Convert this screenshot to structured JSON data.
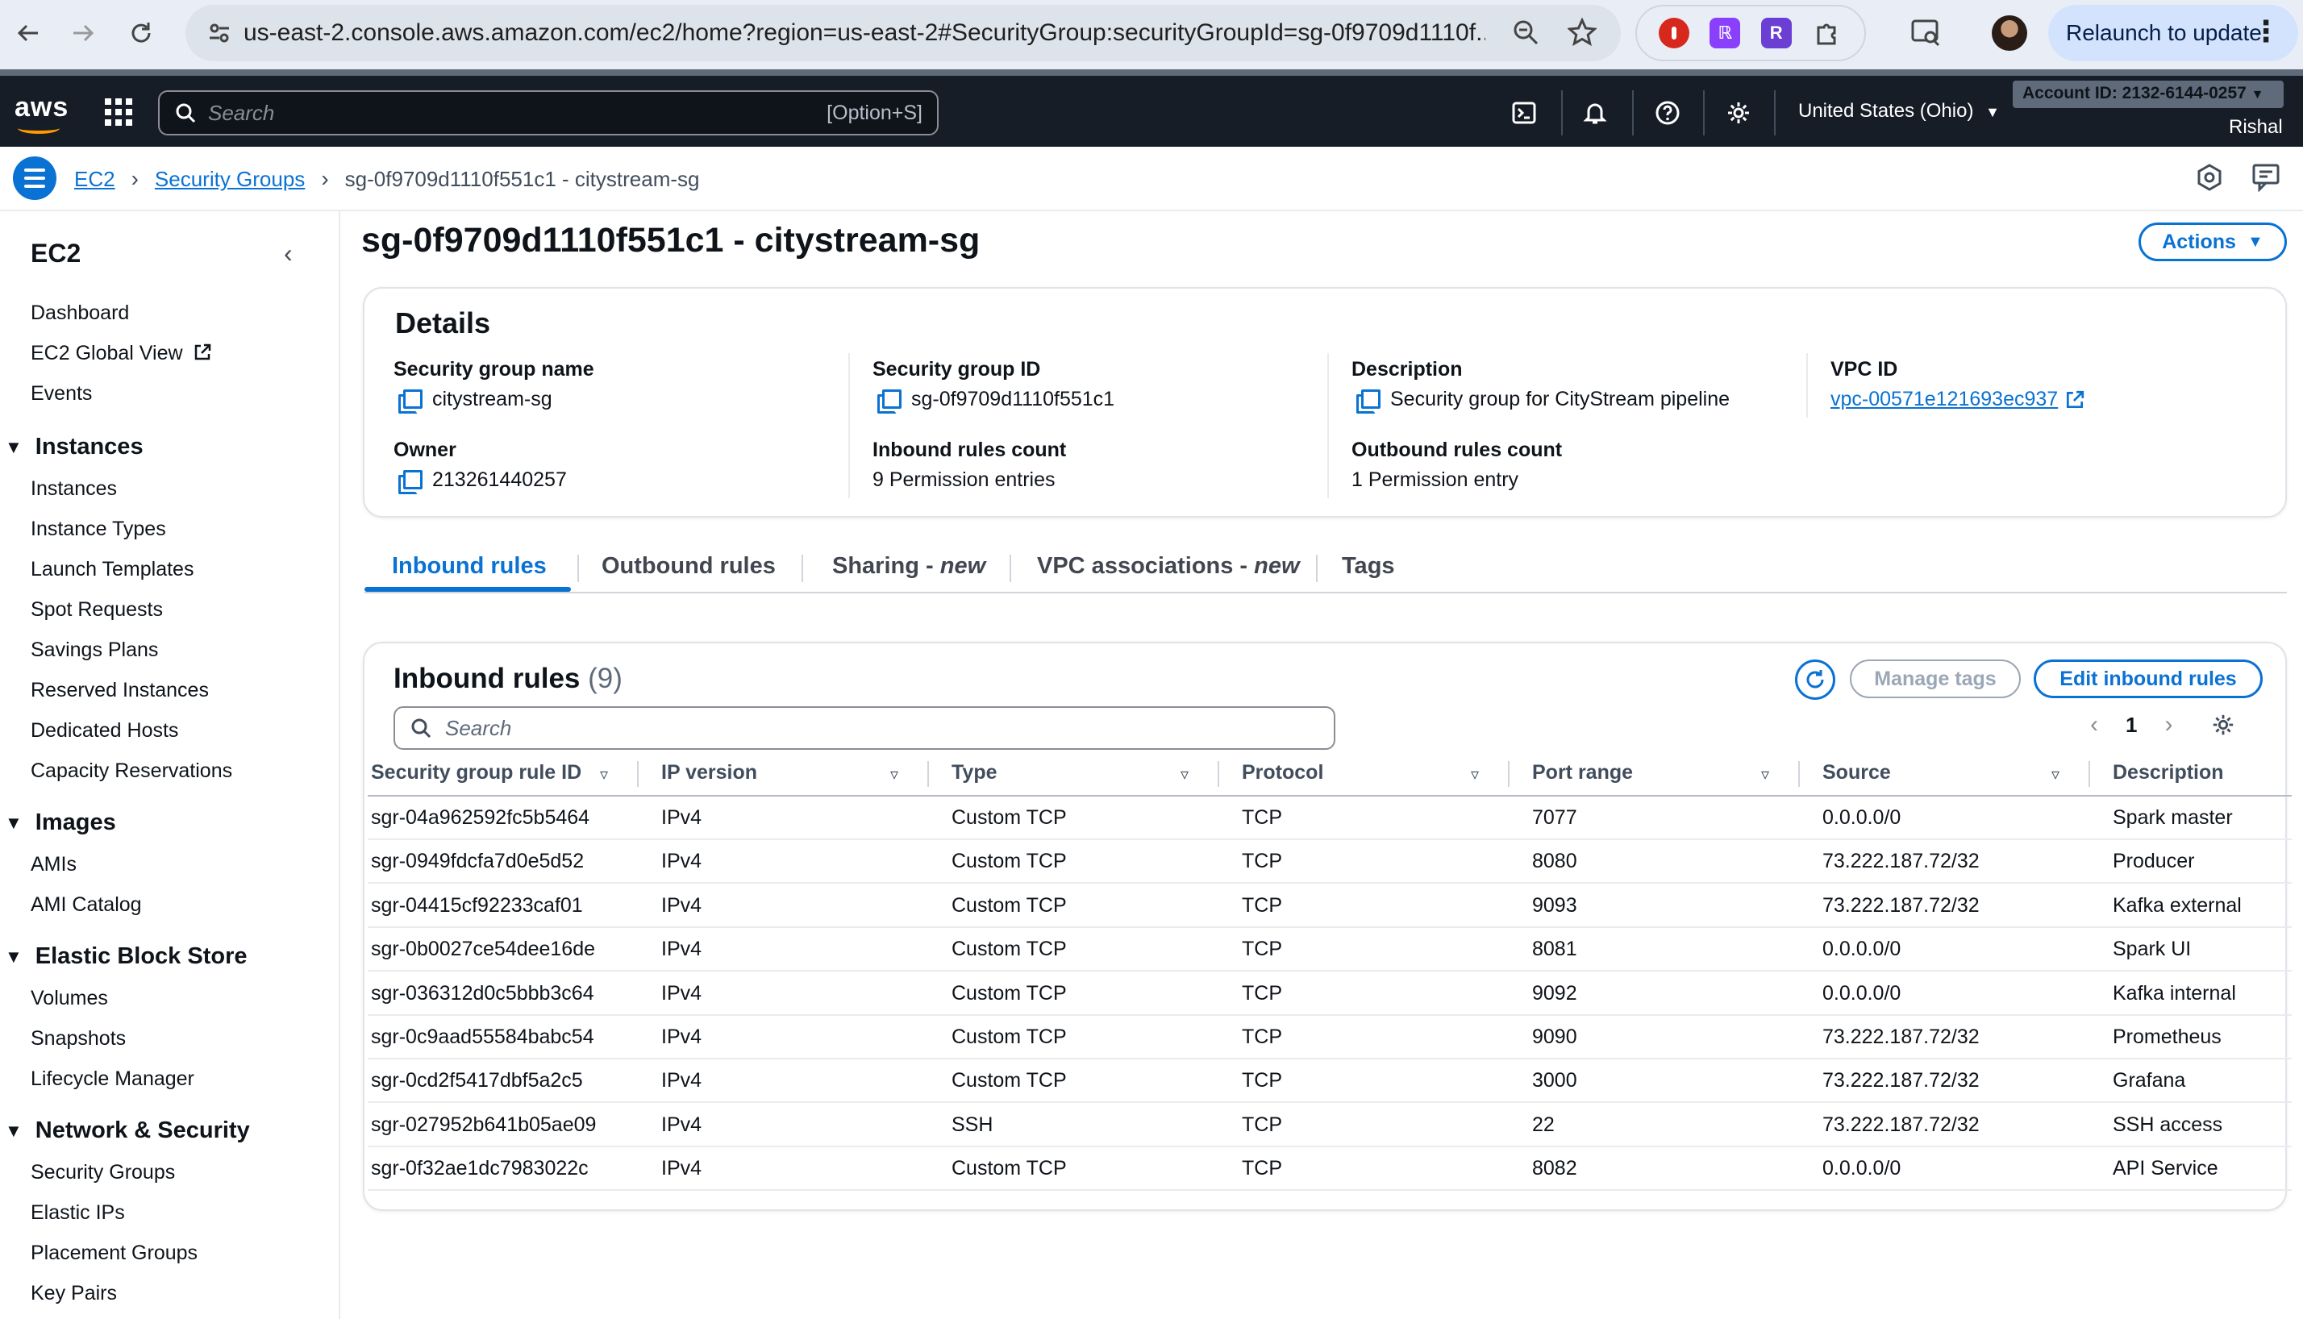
{
  "browser": {
    "url": "us-east-2.console.aws.amazon.com/ec2/home?region=us-east-2#SecurityGroup:securityGroupId=sg-0f9709d1110f...",
    "relaunch_label": "Relaunch to update"
  },
  "aws": {
    "logo": "aws",
    "search_placeholder": "Search",
    "search_shortcut": "[Option+S]",
    "region": "United States (Ohio)",
    "account": "Account ID: 2132-6144-0257",
    "user": "Rishal"
  },
  "breadcrumb": {
    "items": [
      "EC2",
      "Security Groups"
    ],
    "current": "sg-0f9709d1110f551c1 - citystream-sg"
  },
  "sidenav": {
    "title": "EC2",
    "top_items": [
      "Dashboard",
      "EC2 Global View",
      "Events"
    ],
    "sections": [
      {
        "label": "Instances",
        "items": [
          "Instances",
          "Instance Types",
          "Launch Templates",
          "Spot Requests",
          "Savings Plans",
          "Reserved Instances",
          "Dedicated Hosts",
          "Capacity Reservations"
        ]
      },
      {
        "label": "Images",
        "items": [
          "AMIs",
          "AMI Catalog"
        ]
      },
      {
        "label": "Elastic Block Store",
        "items": [
          "Volumes",
          "Snapshots",
          "Lifecycle Manager"
        ]
      },
      {
        "label": "Network & Security",
        "items": [
          "Security Groups",
          "Elastic IPs",
          "Placement Groups",
          "Key Pairs"
        ]
      }
    ]
  },
  "page": {
    "title": "sg-0f9709d1110f551c1 - citystream-sg",
    "actions_label": "Actions"
  },
  "details": {
    "heading": "Details",
    "sg_name_label": "Security group name",
    "sg_name": "citystream-sg",
    "sg_id_label": "Security group ID",
    "sg_id": "sg-0f9709d1110f551c1",
    "description_label": "Description",
    "description": "Security group for CityStream pipeline",
    "vpc_label": "VPC ID",
    "vpc_id": "vpc-00571e121693ec937",
    "owner_label": "Owner",
    "owner": "213261440257",
    "inbound_count_label": "Inbound rules count",
    "inbound_count": "9 Permission entries",
    "outbound_count_label": "Outbound rules count",
    "outbound_count": "1 Permission entry"
  },
  "tabs": {
    "inbound": "Inbound rules",
    "outbound": "Outbound rules",
    "sharing": "Sharing - ",
    "sharing_new": "new",
    "vpc_assoc": "VPC associations - ",
    "vpc_assoc_new": "new",
    "tags": "Tags"
  },
  "inbound": {
    "title": "Inbound rules",
    "count": "(9)",
    "manage_tags": "Manage tags",
    "edit_rules": "Edit inbound rules",
    "search_placeholder": "Search",
    "page": "1",
    "columns": [
      "Security group rule ID",
      "IP version",
      "Type",
      "Protocol",
      "Port range",
      "Source",
      "Description"
    ],
    "rows": [
      [
        "sgr-04a962592fc5b5464",
        "IPv4",
        "Custom TCP",
        "TCP",
        "7077",
        "0.0.0.0/0",
        "Spark master"
      ],
      [
        "sgr-0949fdcfa7d0e5d52",
        "IPv4",
        "Custom TCP",
        "TCP",
        "8080",
        "73.222.187.72/32",
        "Producer"
      ],
      [
        "sgr-04415cf92233caf01",
        "IPv4",
        "Custom TCP",
        "TCP",
        "9093",
        "73.222.187.72/32",
        "Kafka external"
      ],
      [
        "sgr-0b0027ce54dee16de",
        "IPv4",
        "Custom TCP",
        "TCP",
        "8081",
        "0.0.0.0/0",
        "Spark UI"
      ],
      [
        "sgr-036312d0c5bbb3c64",
        "IPv4",
        "Custom TCP",
        "TCP",
        "9092",
        "0.0.0.0/0",
        "Kafka internal"
      ],
      [
        "sgr-0c9aad55584babc54",
        "IPv4",
        "Custom TCP",
        "TCP",
        "9090",
        "73.222.187.72/32",
        "Prometheus"
      ],
      [
        "sgr-0cd2f5417dbf5a2c5",
        "IPv4",
        "Custom TCP",
        "TCP",
        "3000",
        "73.222.187.72/32",
        "Grafana"
      ],
      [
        "sgr-027952b641b05ae09",
        "IPv4",
        "SSH",
        "TCP",
        "22",
        "73.222.187.72/32",
        "SSH access"
      ],
      [
        "sgr-0f32ae1dc7983022c",
        "IPv4",
        "Custom TCP",
        "TCP",
        "8082",
        "0.0.0.0/0",
        "API Service"
      ]
    ]
  }
}
